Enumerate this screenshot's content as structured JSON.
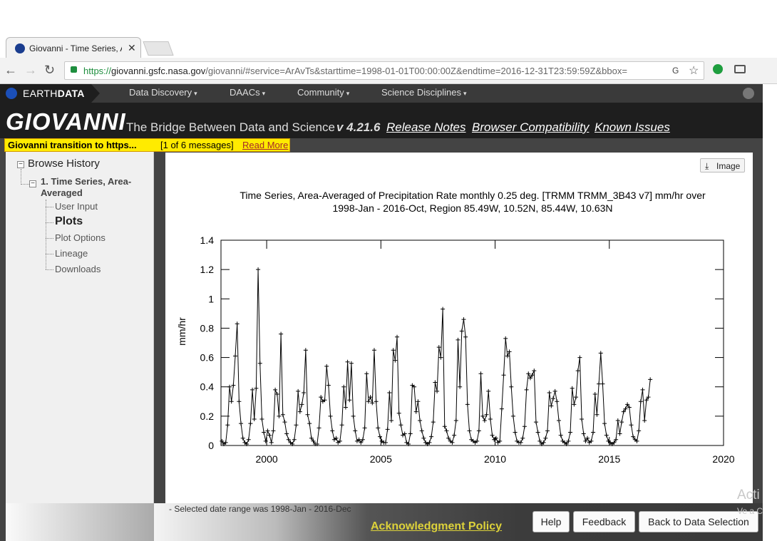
{
  "browser": {
    "tab_title": "Giovanni - Time Series, A",
    "tab_close": "✕",
    "url_proto": "https://",
    "url_host": "giovanni.gsfc.nasa.gov",
    "url_rest": "/giovanni/#service=ArAvTs&starttime=1998-01-01T00:00:00Z&endtime=2016-12-31T23:59:59Z&bbox=",
    "back_icon": "←",
    "forward_icon": "→",
    "reload_icon": "↻",
    "star_icon": "☆",
    "translate_icon": "G"
  },
  "earthdata": {
    "brand_light": "EARTH",
    "brand_bold": "DATA",
    "nav": [
      "Data Discovery",
      "DAACs",
      "Community",
      "Science Disciplines"
    ],
    "caret": "▾"
  },
  "giovanni": {
    "logo": "GIOVANNI",
    "tagline": "The Bridge Between Data and Science",
    "version": "v 4.21.6",
    "links": [
      "Release Notes",
      "Browser Compatibility",
      "Known Issues"
    ]
  },
  "alert": {
    "message": "Giovanni transition to https...",
    "count": "[1 of 6 messages]",
    "read_more": "Read More"
  },
  "sidebar": {
    "root": "Browse History",
    "item_title": "1. Time Series, Area-Averaged",
    "toggle": "−",
    "children": [
      "User Input",
      "Plots",
      "Plot Options",
      "Lineage",
      "Downloads"
    ],
    "selected": "Plots"
  },
  "content": {
    "image_button": "Image",
    "image_icon": "⤓",
    "date_note": "- Selected date range was 1998-Jan - 2016-Dec"
  },
  "footer": {
    "ack": "Acknowledgment Policy",
    "help": "Help",
    "feedback": "Feedback",
    "back": "Back to Data Selection"
  },
  "overlay": {
    "activate": "Acti",
    "activate_sub": "Ve a C"
  },
  "chart_data": {
    "type": "line",
    "title": "Time Series, Area-Averaged of Precipitation Rate monthly 0.25 deg. [TRMM TRMM_3B43 v7] mm/hr over 1998-Jan - 2016-Oct, Region 85.49W, 10.52N, 85.44W, 10.63N",
    "ylabel": "mm/hr",
    "xlabel": "",
    "xlim": [
      1998,
      2020
    ],
    "ylim": [
      0,
      1.4
    ],
    "xticks": [
      "2000",
      "2005",
      "2010",
      "2015",
      "2020"
    ],
    "yticks": [
      "0",
      "0.2",
      "0.4",
      "0.6",
      "0.8",
      "1",
      "1.2",
      "1.4"
    ],
    "marker": "+",
    "color": "#000000",
    "series": [
      {
        "values": [
          0.03,
          0.01,
          0.02,
          0.14,
          0.4,
          0.3,
          0.41,
          0.61,
          0.83,
          0.3,
          0.15,
          0.05,
          0.02,
          0.01,
          0.04,
          0.15,
          0.38,
          0.18,
          0.39,
          1.2,
          0.56,
          0.18,
          0.09,
          0.03,
          0.1,
          0.07,
          0.02,
          0.1,
          0.38,
          0.35,
          0.2,
          0.76,
          0.21,
          0.16,
          0.08,
          0.04,
          0.02,
          0.01,
          0.04,
          0.14,
          0.37,
          0.23,
          0.28,
          0.36,
          0.65,
          0.21,
          0.15,
          0.05,
          0.03,
          0.01,
          0.01,
          0.12,
          0.33,
          0.3,
          0.31,
          0.54,
          0.41,
          0.2,
          0.1,
          0.04,
          0.05,
          0.02,
          0.03,
          0.14,
          0.4,
          0.26,
          0.57,
          0.31,
          0.56,
          0.2,
          0.1,
          0.03,
          0.04,
          0.02,
          0.04,
          0.12,
          0.49,
          0.3,
          0.33,
          0.29,
          0.65,
          0.3,
          0.12,
          0.06,
          0.03,
          0.02,
          0.02,
          0.11,
          0.36,
          0.17,
          0.65,
          0.58,
          0.74,
          0.22,
          0.14,
          0.07,
          0.08,
          0.02,
          0.01,
          0.08,
          0.41,
          0.4,
          0.23,
          0.3,
          0.17,
          0.1,
          0.05,
          0.02,
          0.01,
          0.02,
          0.06,
          0.16,
          0.43,
          0.37,
          0.67,
          0.6,
          0.93,
          0.13,
          0.1,
          0.05,
          0.03,
          0.02,
          0.07,
          0.17,
          0.72,
          0.4,
          0.78,
          0.86,
          0.74,
          0.28,
          0.1,
          0.04,
          0.03,
          0.02,
          0.03,
          0.1,
          0.49,
          0.2,
          0.17,
          0.21,
          0.37,
          0.18,
          0.07,
          0.04,
          0.05,
          0.02,
          0.03,
          0.25,
          0.48,
          0.73,
          0.61,
          0.64,
          0.4,
          0.2,
          0.09,
          0.03,
          0.02,
          0.02,
          0.05,
          0.13,
          0.38,
          0.49,
          0.46,
          0.48,
          0.51,
          0.16,
          0.09,
          0.03,
          0.01,
          0.02,
          0.05,
          0.1,
          0.36,
          0.27,
          0.32,
          0.37,
          0.3,
          0.17,
          0.07,
          0.03,
          0.02,
          0.01,
          0.03,
          0.09,
          0.39,
          0.28,
          0.33,
          0.51,
          0.6,
          0.18,
          0.08,
          0.03,
          0.05,
          0.02,
          0.03,
          0.09,
          0.35,
          0.21,
          0.42,
          0.63,
          0.42,
          0.15,
          0.07,
          0.03,
          0.02,
          0.01,
          0.02,
          0.04,
          0.17,
          0.08,
          0.16,
          0.23,
          0.25,
          0.28,
          0.26,
          0.14,
          0.06,
          0.04,
          0.03,
          0.1,
          0.3,
          0.38,
          0.17,
          0.31,
          0.33,
          0.45
        ]
      }
    ]
  }
}
